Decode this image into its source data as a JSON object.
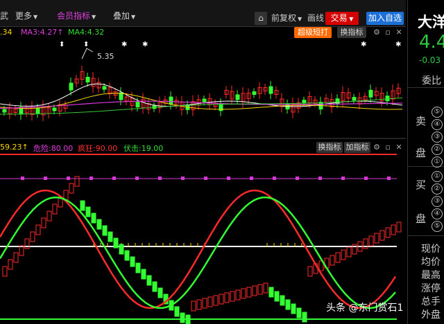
{
  "toolbar": {
    "left_item": "武",
    "more": "更多",
    "member_indicator": "会员指标",
    "overlay": "叠加",
    "adjust": "前复权",
    "draw_line": "画线",
    "trade": "交易",
    "add_watchlist": "加入自选",
    "fav_icon": "cart-icon"
  },
  "ma_bar": {
    "ma_prefix": ".34",
    "ma3": "MA3:4.27",
    "ma3_arrow": "↑",
    "ma4": "MA4:4.32",
    "super_short": "超级短打",
    "switch_indicator": "换指标"
  },
  "price_annotation": "5.35",
  "indicator_bar": {
    "v1": "59.23",
    "v1_arrow": "↑",
    "danger": "危险:80.00",
    "crazy": "疯狂:90.00",
    "ambush": "伏击:19.00",
    "switch_indicator": "换指标",
    "add_indicator": "加指标"
  },
  "right_panel": {
    "stock_name": "大洋",
    "price": "4.4",
    "change": "-0.03",
    "weibi": "委比",
    "sell": "卖",
    "pan1": "盘",
    "buy": "买",
    "pan2": "盘",
    "sell_levels": [
      "⑤",
      "④",
      "③",
      "②",
      "①"
    ],
    "buy_levels": [
      "①",
      "②",
      "③",
      "④",
      "⑤"
    ],
    "stats": [
      "现价",
      "均价",
      "最高",
      "涨停",
      "总手",
      "外盘"
    ]
  },
  "watermark": "头条 @东门赏石1",
  "colors": {
    "up": "#ff2a2a",
    "down": "#33ff33",
    "yellow": "#ffd700",
    "magenta": "#d838d8",
    "orange_btn": "#ff6a00",
    "trade_btn": "#e00000",
    "add_btn": "#1c6fd6",
    "price_green": "#2ecc40"
  },
  "chart_data": [
    {
      "type": "candlestick",
      "title": "",
      "annotations": [
        "5.35"
      ],
      "series": [
        {
          "name": "MA3",
          "color": "#e8e8e8"
        },
        {
          "name": "MA4",
          "color": "#33cc33"
        }
      ]
    },
    {
      "type": "line",
      "title": "",
      "reference_lines": [
        {
          "name": "危险",
          "value": 80
        },
        {
          "name": "疯狂",
          "value": 90
        },
        {
          "name": "伏击",
          "value": 19
        }
      ],
      "series": [
        {
          "name": "red line",
          "color": "#ff2a2a"
        },
        {
          "name": "green line",
          "color": "#33ff33"
        }
      ]
    }
  ]
}
